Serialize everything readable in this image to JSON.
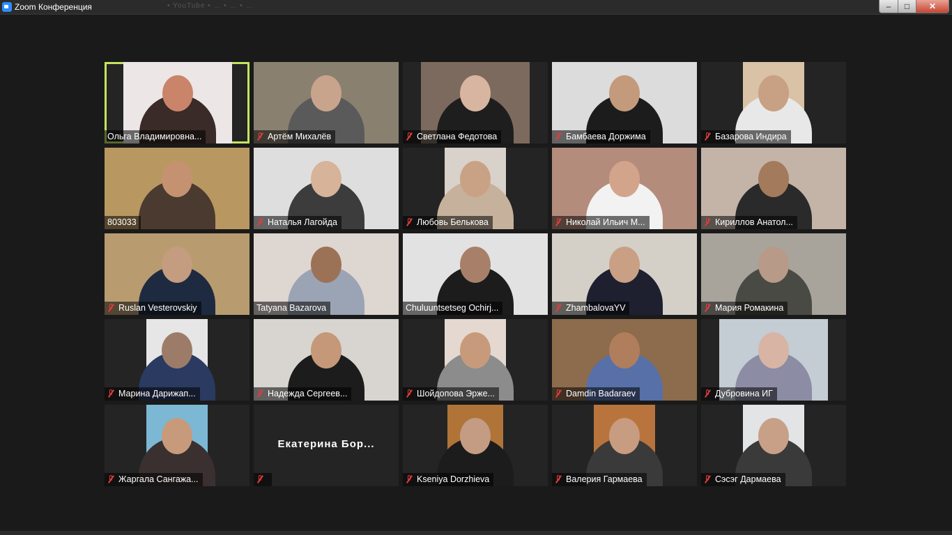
{
  "window": {
    "title": "Zoom Конференция",
    "background_tabs": "• YouTube  •  …  •  …  •  …"
  },
  "window_controls": {
    "minimize": "–",
    "maximize": "□",
    "close": "✕"
  },
  "colors": {
    "background": "#1a1a1a",
    "active_speaker": "#c5e45f",
    "muted_icon": "#e03c3c"
  },
  "participants": [
    {
      "name": "Ольга Владимировна...",
      "muted": false,
      "video": true,
      "active": true
    },
    {
      "name": "Артём Михалёв",
      "muted": true,
      "video": true
    },
    {
      "name": "Светлана Федотова",
      "muted": true,
      "video": true
    },
    {
      "name": "Бамбаева Доржима",
      "muted": true,
      "video": true
    },
    {
      "name": "Базарова Индира",
      "muted": true,
      "video": true
    },
    {
      "name": "803033",
      "muted": false,
      "video": true
    },
    {
      "name": "Наталья Лагойда",
      "muted": true,
      "video": true
    },
    {
      "name": "Любовь Белькова",
      "muted": true,
      "video": true
    },
    {
      "name": "Николай Ильич М...",
      "muted": true,
      "video": true
    },
    {
      "name": "Кириллов Анатол...",
      "muted": true,
      "video": true
    },
    {
      "name": "Ruslan Vesterovskiy",
      "muted": true,
      "video": true
    },
    {
      "name": "Tatyana Bazarova",
      "muted": false,
      "video": true
    },
    {
      "name": "Chuluuntsetseg Ochirj...",
      "muted": false,
      "video": true
    },
    {
      "name": "ZhambalovaYV",
      "muted": true,
      "video": true
    },
    {
      "name": "Мария Ромакина",
      "muted": true,
      "video": true
    },
    {
      "name": "Марина Дарижап...",
      "muted": true,
      "video": true
    },
    {
      "name": "Надежда Сергеев...",
      "muted": true,
      "video": true
    },
    {
      "name": "Шойдопова Эрже...",
      "muted": true,
      "video": true
    },
    {
      "name": "Damdin Badaraev",
      "muted": true,
      "video": true
    },
    {
      "name": "Дубровина ИГ",
      "muted": true,
      "video": true
    },
    {
      "name": "Жаргала Сангажа...",
      "muted": true,
      "video": true
    },
    {
      "name": "",
      "muted": true,
      "video": false,
      "display_name": "Екатерина  Бор..."
    },
    {
      "name": "Kseniya Dorzhieva",
      "muted": true,
      "video": true
    },
    {
      "name": "Валерия Гармаева",
      "muted": true,
      "video": true
    },
    {
      "name": "Сэсэг Дармаева",
      "muted": true,
      "video": true
    }
  ]
}
